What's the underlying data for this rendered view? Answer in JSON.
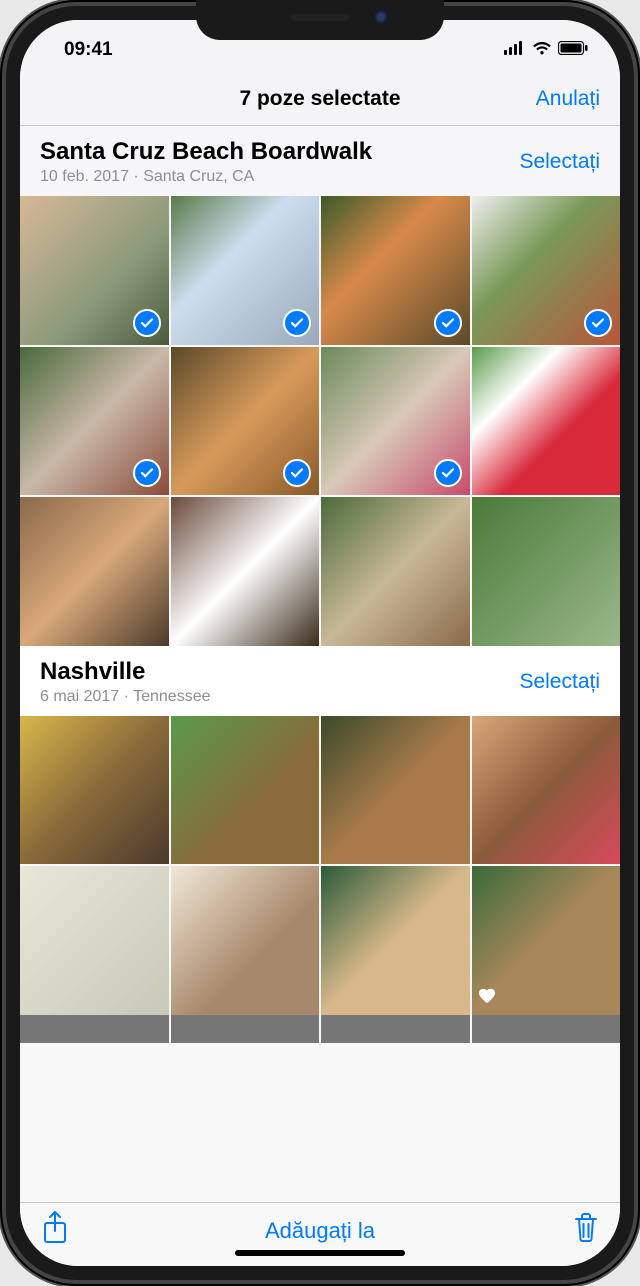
{
  "status": {
    "time": "09:41"
  },
  "nav": {
    "title": "7 poze selectate",
    "cancel": "Anulați"
  },
  "sections": [
    {
      "title": "Santa Cruz Beach Boardwalk",
      "subtitle": "10 feb. 2017   ·   Santa Cruz, CA",
      "select_label": "Selectați",
      "photos": [
        {
          "selected": true,
          "favorite": false
        },
        {
          "selected": true,
          "favorite": false
        },
        {
          "selected": true,
          "favorite": false
        },
        {
          "selected": true,
          "favorite": false
        },
        {
          "selected": true,
          "favorite": false
        },
        {
          "selected": true,
          "favorite": false
        },
        {
          "selected": true,
          "favorite": false
        },
        {
          "selected": false,
          "favorite": false
        },
        {
          "selected": false,
          "favorite": false
        },
        {
          "selected": false,
          "favorite": false
        },
        {
          "selected": false,
          "favorite": false
        },
        {
          "selected": false,
          "favorite": false
        }
      ]
    },
    {
      "title": "Nashville",
      "subtitle": "6 mai 2017   ·   Tennessee",
      "select_label": "Selectați",
      "photos": [
        {
          "selected": false,
          "favorite": false
        },
        {
          "selected": false,
          "favorite": false
        },
        {
          "selected": false,
          "favorite": false
        },
        {
          "selected": false,
          "favorite": false
        },
        {
          "selected": false,
          "favorite": false
        },
        {
          "selected": false,
          "favorite": false
        },
        {
          "selected": false,
          "favorite": false
        },
        {
          "selected": false,
          "favorite": true
        }
      ]
    }
  ],
  "toolbar": {
    "add_to": "Adăugați la"
  }
}
